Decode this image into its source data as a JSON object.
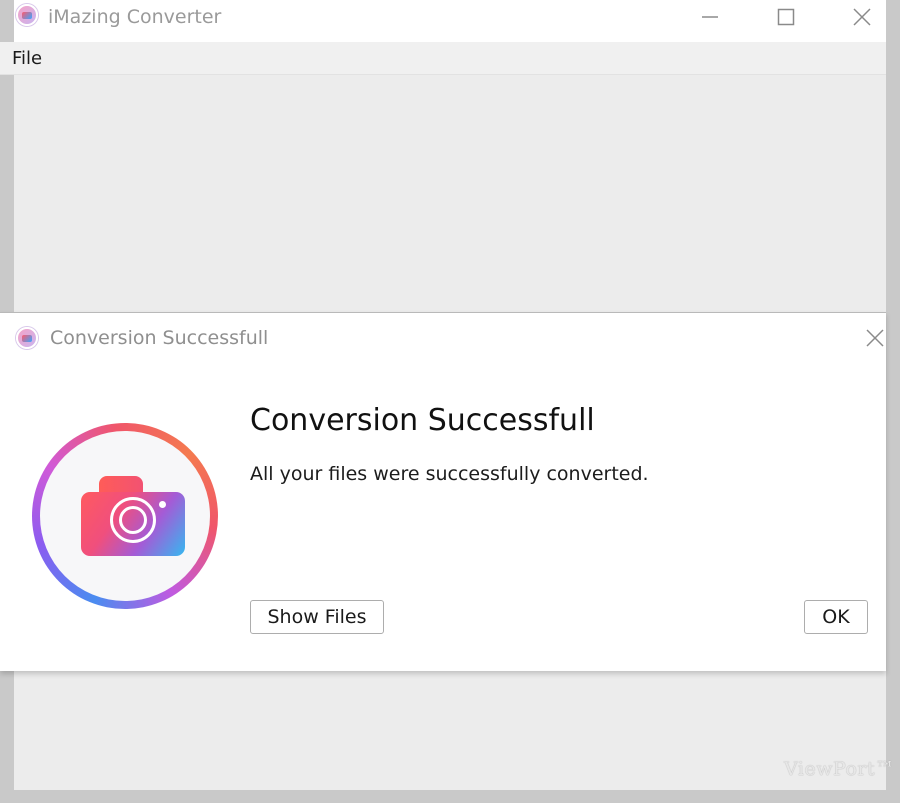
{
  "main_window": {
    "title": "iMazing Converter",
    "menu": {
      "file_label": "File"
    }
  },
  "dialog": {
    "title": "Conversion Successfull",
    "heading": "Conversion Successfull",
    "message": "All your files were successfully converted.",
    "buttons": {
      "show_files_label": "Show Files",
      "ok_label": "OK"
    }
  },
  "watermark": {
    "text": "ViewPort™"
  },
  "icons": {
    "app": "imazing-converter-icon",
    "minimize": "minimize-icon",
    "maximize": "maximize-icon",
    "close": "close-icon",
    "logo": "camera-logo-icon"
  },
  "colors": {
    "accent_red": "#ff5a5f",
    "accent_purple": "#a45bd6",
    "accent_blue": "#35b8f0",
    "window_bg": "#ececec"
  }
}
